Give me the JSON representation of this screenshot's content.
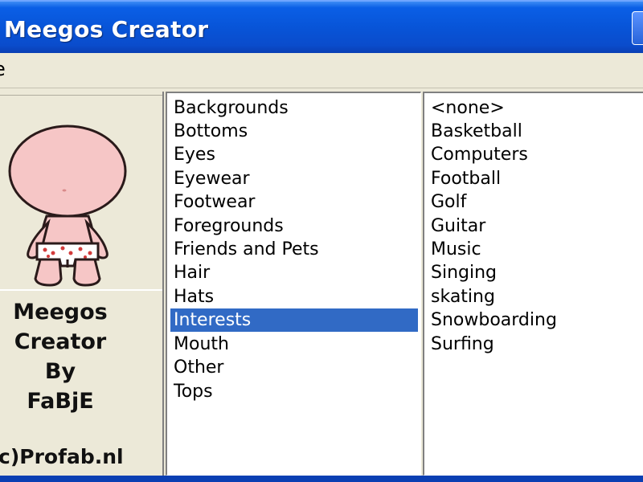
{
  "window": {
    "title": "Meegos Creator"
  },
  "menu": {
    "items": [
      {
        "label": "e"
      }
    ]
  },
  "credit": {
    "lines": [
      "Meegos",
      "Creator",
      "By",
      "FaBjE"
    ],
    "copyright": "c)Profab.nl"
  },
  "categories": {
    "items": [
      "Backgrounds",
      "Bottoms",
      "Eyes",
      "Eyewear",
      "Footwear",
      "Foregrounds",
      "Friends and Pets",
      "Hair",
      "Hats",
      "Interests",
      "Mouth",
      "Other",
      "Tops"
    ],
    "selected": "Interests"
  },
  "interests": {
    "items": [
      "<none>",
      "Basketball",
      "Computers",
      "Football",
      "Golf",
      "Guitar",
      "Music",
      "Singing",
      "skating",
      "Snowboarding",
      "Surfing"
    ]
  },
  "colors": {
    "titlebar": "#0853d6",
    "selection": "#316ac5",
    "skin": "#f6c6c6",
    "underwear_dots": "#d23b3b",
    "face": "#ece9d8"
  }
}
